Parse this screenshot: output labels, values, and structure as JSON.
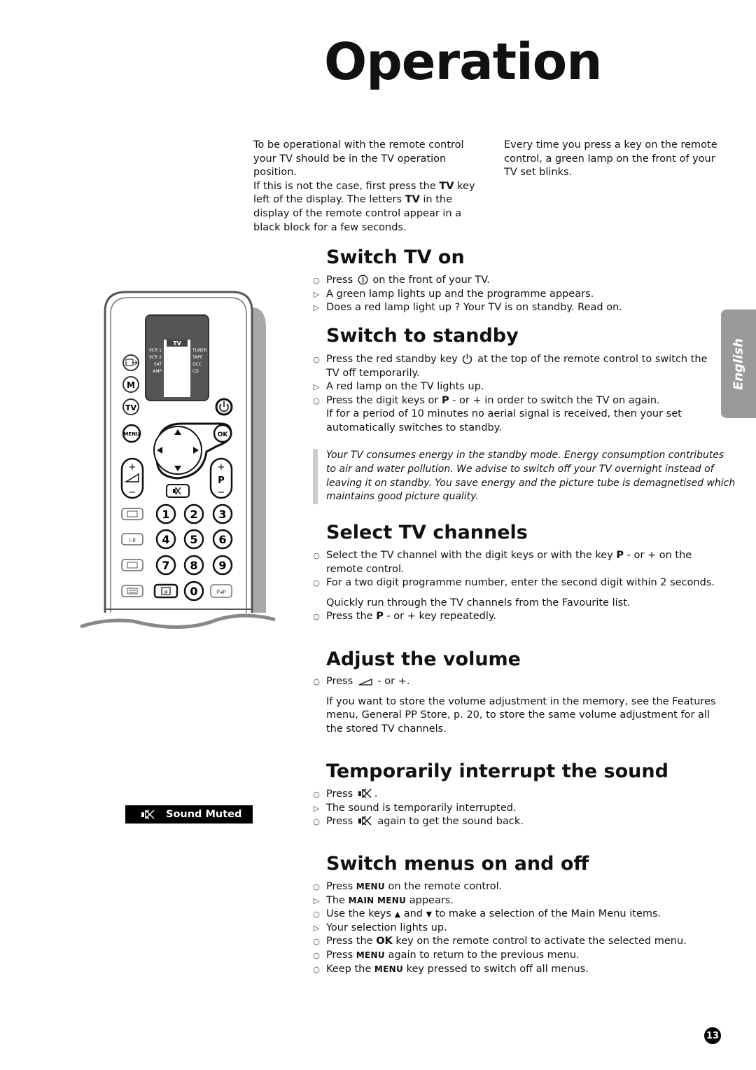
{
  "page": {
    "title": "Operation",
    "language_tab": "English",
    "page_number": "13"
  },
  "intro": {
    "left_p1": "To be operational with the remote control your TV should be in the TV operation position.",
    "left_p2_a": "If this is not the case, first press the ",
    "left_p2_b1": "TV",
    "left_p2_c": " key left of the display. The letters ",
    "left_p2_b2": "TV",
    "left_p2_d": " in the display of the remote control appear in a black block for a few seconds.",
    "right_p1": "Every time you press a key on the remote control, a green lamp on the front of your TV set blinks."
  },
  "sections": {
    "switch_on": {
      "heading": "Switch TV on",
      "i1_a": "Press ",
      "i1_b": " on the front of your TV.",
      "i2": "A green lamp lights up and the programme appears.",
      "i3": "Does a red lamp light up ? Your TV is on standby. Read on."
    },
    "standby": {
      "heading": "Switch to standby",
      "i1_a": "Press the red standby key ",
      "i1_b": " at the top of the remote control to switch the TV off temporarily.",
      "i2": "A red lamp on the TV lights up.",
      "i3_a": "Press the digit keys or ",
      "i3_b": "P",
      "i3_c": " - or +  in order to switch the TV on again.",
      "i4": "If for a period of 10 minutes no aerial signal is received, then your set automatically switches to standby.",
      "note": "Your TV consumes energy in the standby mode. Energy consumption contributes to air and water pollution. We advise to switch off your TV overnight instead of leaving it on standby. You save energy and the picture tube is demagnetised which maintains good picture quality."
    },
    "channels": {
      "heading": "Select TV channels",
      "i1_a": "Select the TV channel with the digit keys or with the key ",
      "i1_b": "P",
      "i1_c": " - or + on the remote control.",
      "i2": "For a two digit programme number, enter the second digit within 2 seconds.",
      "p1": "Quickly run through the TV channels from the Favourite list.",
      "i3_a": "Press the ",
      "i3_b": "P",
      "i3_c": " - or + key repeatedly."
    },
    "volume": {
      "heading": "Adjust the volume",
      "i1_a": "Press ",
      "i1_b": " - or +.",
      "p1": "If you want to store the volume adjustment in the memory, see the Features menu, General PP Store, p. 20, to store the same volume adjustment for all the stored TV channels."
    },
    "mute": {
      "heading": "Temporarily interrupt the sound",
      "i1_a": "Press ",
      "i1_b": ".",
      "i2": "The sound is temporarily interrupted.",
      "i3_a": "Press ",
      "i3_b": " again to get the sound back.",
      "banner": "Sound Muted"
    },
    "menus": {
      "heading": "Switch menus on and off",
      "i1_a": "Press ",
      "i1_b": "MENU",
      "i1_c": " on the remote control.",
      "i2_a": "The ",
      "i2_b": "MAIN MENU",
      "i2_c": " appears.",
      "i3_a": "Use the keys ",
      "i3_b": "▲",
      "i3_c": " and ",
      "i3_d": "▼",
      "i3_e": " to make a selection of the Main Menu items.",
      "i4": "Your selection lights up.",
      "i5_a": "Press the ",
      "i5_b": "OK",
      "i5_c": " key on the remote control to activate the selected menu.",
      "i6_a": "Press ",
      "i6_b": "MENU",
      "i6_c": " again to return to the previous menu.",
      "i7_a": "Keep the ",
      "i7_b": "MENU",
      "i7_c": " key pressed to switch off all menus."
    }
  },
  "markers": {
    "action": "○",
    "result": "▷"
  },
  "remote": {
    "display_mode": "TV",
    "left_modes": [
      "VCR 1",
      "VCR 2",
      "SAT",
      "AMP"
    ],
    "right_modes": [
      "TUNER",
      "TAPE",
      "DCC",
      "CD"
    ],
    "key_m": "M",
    "key_tv": "TV",
    "key_menu": "MENU",
    "key_ok": "OK",
    "key_plus": "+",
    "key_minus": "−",
    "key_p": "P",
    "key_dual": "I-II",
    "key_pp": "P◂P",
    "digits": [
      "1",
      "2",
      "3",
      "4",
      "5",
      "6",
      "7",
      "8",
      "9",
      "0"
    ]
  }
}
